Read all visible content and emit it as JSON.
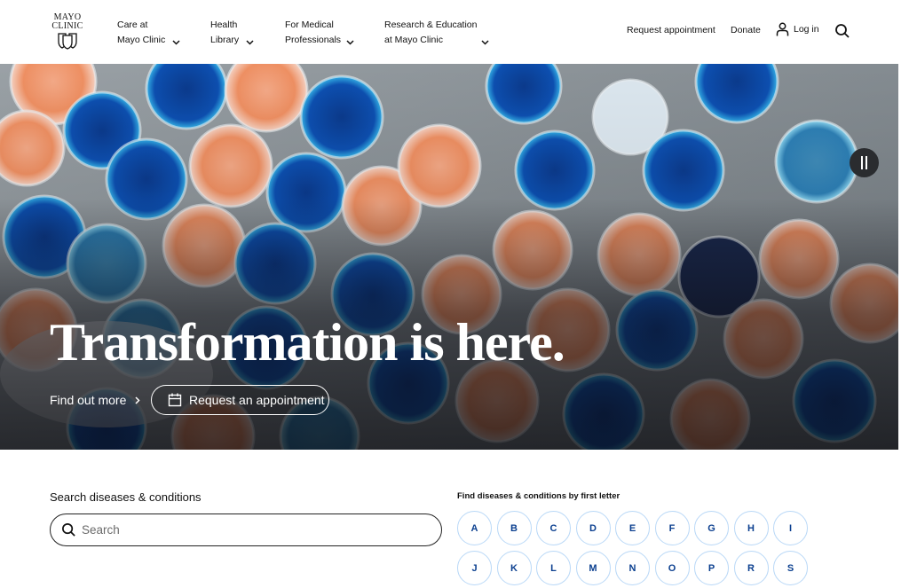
{
  "header": {
    "logo": {
      "line1": "MAYO",
      "line2": "CLINIC"
    },
    "nav": [
      {
        "line1": "Care at",
        "line2": "Mayo Clinic"
      },
      {
        "line1": "Health",
        "line2": "Library"
      },
      {
        "line1": "For Medical",
        "line2": "Professionals"
      },
      {
        "line1": "Research & Education",
        "line2": "at Mayo Clinic"
      }
    ],
    "utility": {
      "request_appointment": "Request appointment",
      "donate": "Donate",
      "login": "Log in",
      "search_icon": "search-icon"
    }
  },
  "hero": {
    "title": "Transformation is here.",
    "find_out_more": "Find out more",
    "request_appointment": "Request an appointment",
    "pause_icon": "pause-icon",
    "colors": {
      "overlay": "#000000",
      "text": "#ffffff"
    }
  },
  "search": {
    "label": "Search diseases & conditions",
    "placeholder": "Search",
    "value": ""
  },
  "letters": {
    "label": "Find diseases & conditions by first letter",
    "items": [
      "A",
      "B",
      "C",
      "D",
      "E",
      "F",
      "G",
      "H",
      "I",
      "J",
      "K",
      "L",
      "M",
      "N",
      "O",
      "P",
      "R",
      "S"
    ],
    "colors": {
      "border": "#b9d8f7",
      "text": "#0b3f8f"
    }
  }
}
